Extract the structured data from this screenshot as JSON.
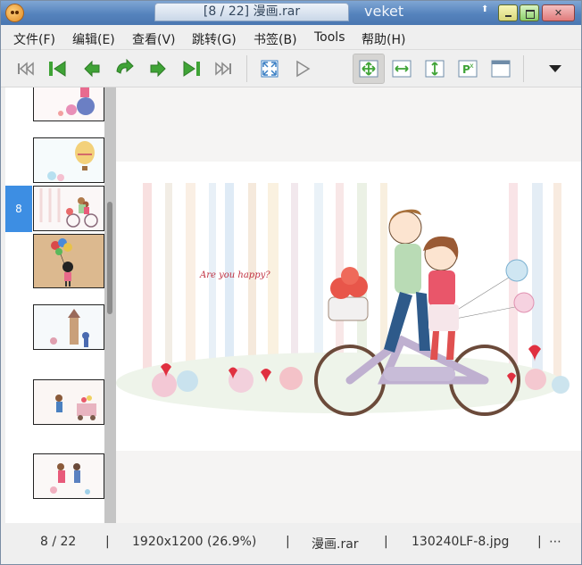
{
  "titlebar": {
    "tab_title": "[8 / 22] 漫画.rar",
    "app_name": "veket",
    "up_glyph": "⬆"
  },
  "menu": {
    "items": [
      {
        "label": "文件(F)"
      },
      {
        "label": "编辑(E)"
      },
      {
        "label": "查看(V)"
      },
      {
        "label": "跳转(G)"
      },
      {
        "label": "书签(B)"
      },
      {
        "label": "Tools"
      },
      {
        "label": "帮助(H)"
      }
    ]
  },
  "toolbar": {
    "icons": [
      "first-page-icon",
      "first-archive-icon",
      "back-icon",
      "rotate-icon",
      "forward-icon",
      "last-archive-icon",
      "last-page-icon",
      "fullscreen-icon",
      "slideshow-icon",
      "best-fit-icon",
      "fit-width-icon",
      "fit-height-icon",
      "manual-zoom-icon",
      "double-page-icon",
      "menu-dropdown-icon"
    ],
    "colors": {
      "green": "#3fa336",
      "gray": "#8a8a8a",
      "blue": "#3a7fc4"
    }
  },
  "sidebar": {
    "selected_number": "8"
  },
  "status": {
    "page": "8 / 22",
    "resolution": "1920x1200 (26.9%)",
    "archive": "漫画.rar",
    "filename": "130240LF-8.jpg",
    "more": "⋯",
    "sep": "|"
  },
  "page_image": {
    "caption": "Are you happy?"
  }
}
